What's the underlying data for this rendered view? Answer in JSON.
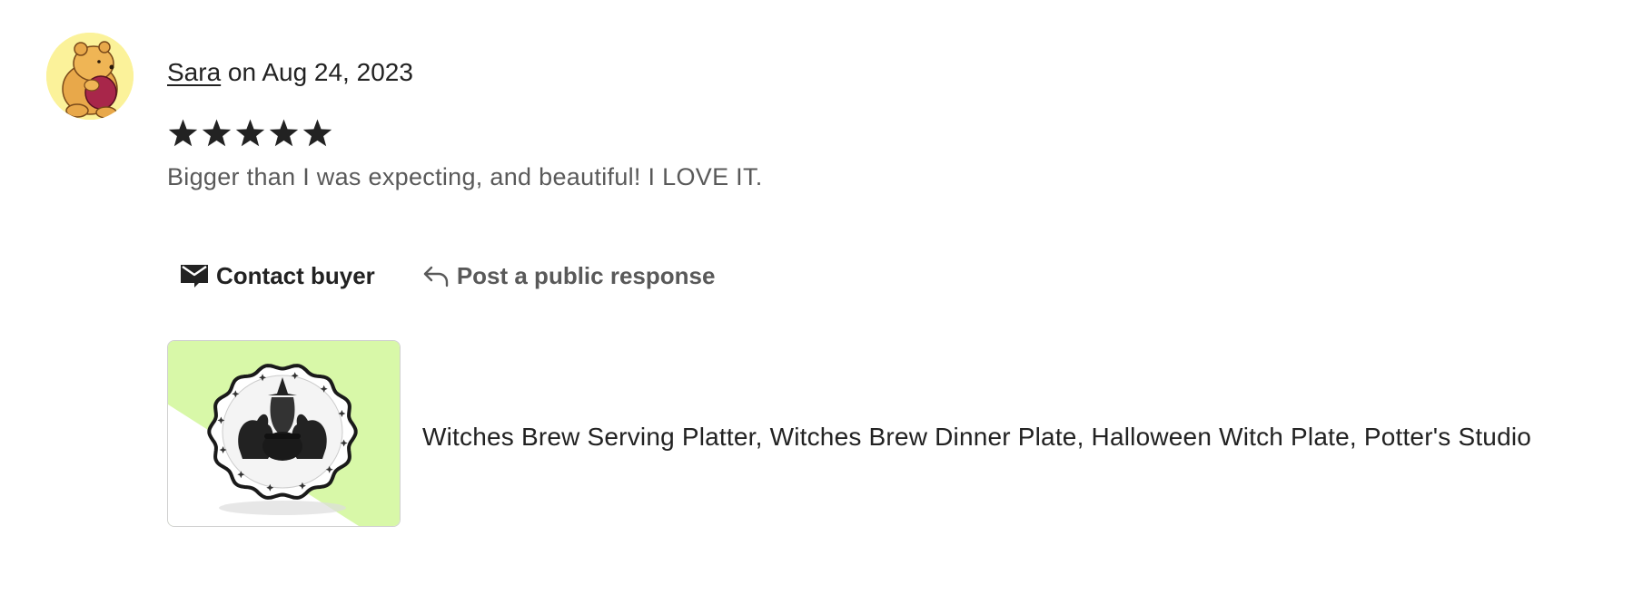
{
  "review": {
    "reviewer_name": "Sara",
    "date_text": " on Aug 24, 2023",
    "rating": 5,
    "rating_max": 5,
    "text": "Bigger than I was expecting, and beautiful! I LOVE IT."
  },
  "actions": {
    "contact_label": "Contact buyer",
    "respond_label": "Post a public response"
  },
  "listing": {
    "title": "Witches Brew Serving Platter, Witches Brew Dinner Plate, Halloween Witch Plate, Potter's Studio"
  },
  "colors": {
    "text_primary": "#222222",
    "text_secondary": "#595959",
    "avatar_bg": "#fbf29a",
    "thumb_accent": "#d8f8a8"
  },
  "icons": {
    "contact": "envelope-icon",
    "respond": "reply-arrow-icon",
    "rating": "star-icon",
    "avatar": "bear-avatar"
  }
}
